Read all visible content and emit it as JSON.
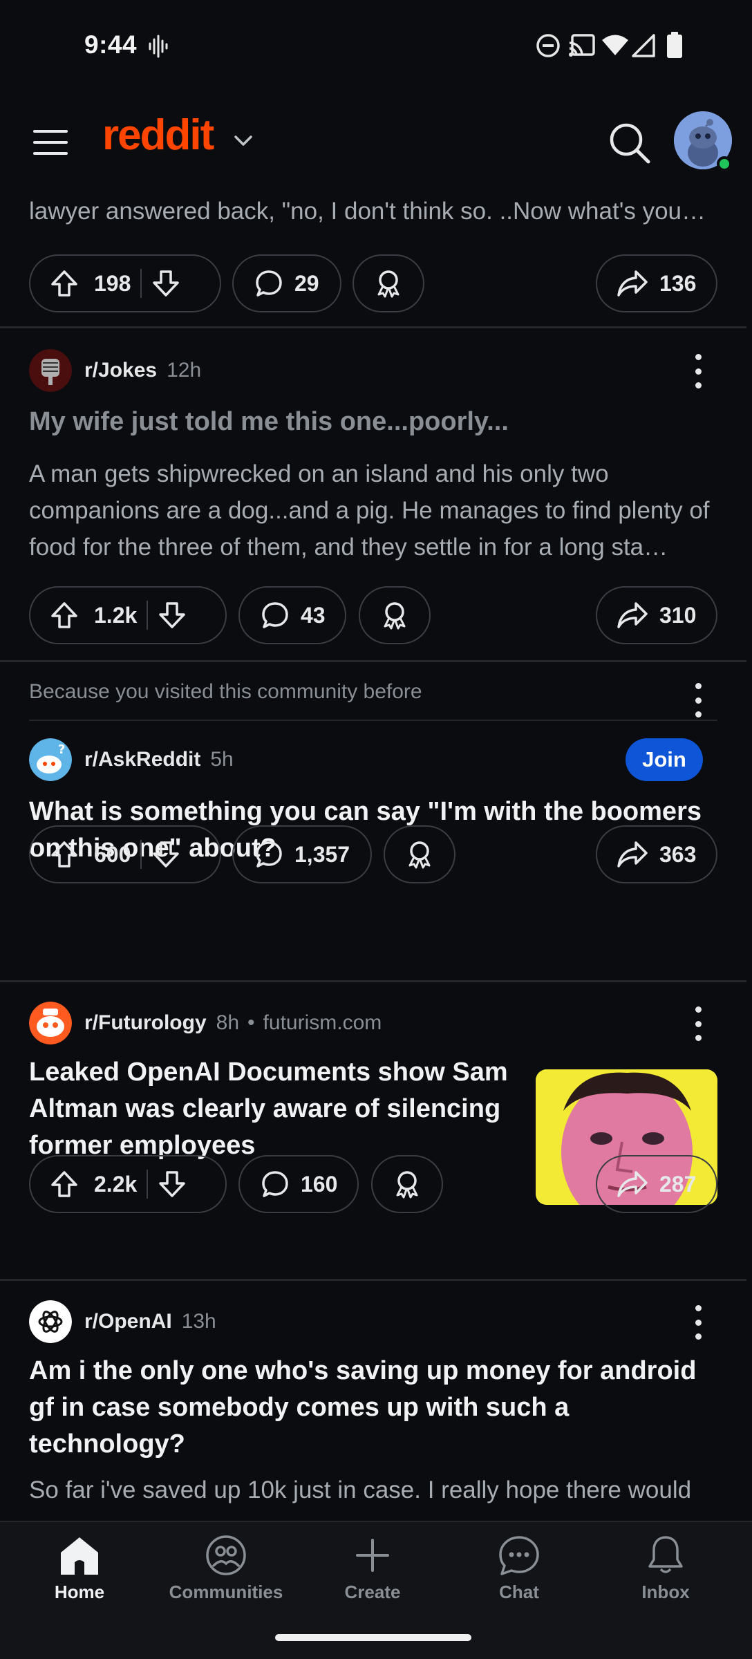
{
  "status_bar": {
    "time": "9:44",
    "icons": [
      "voicemail-waveform-icon",
      "do-not-disturb-icon",
      "cast-icon",
      "wifi-icon",
      "cellular-signal-icon",
      "battery-icon"
    ]
  },
  "header": {
    "logo": "reddit",
    "icons": [
      "menu-icon",
      "chevron-down-icon",
      "search-icon",
      "avatar-icon"
    ],
    "brand_color": "#ff4500"
  },
  "feed": {
    "post0": {
      "teaser": "lawyer answered back, \"no, I don't think so. ..Now what's you…",
      "upvotes": "198",
      "comments": "29",
      "shares": "136"
    },
    "post1": {
      "subreddit": "r/Jokes",
      "age": "12h",
      "title": "My wife just told me this one...poorly...",
      "body": "A man gets shipwrecked on an island and his only two companions are a dog...and a pig. He manages to find plenty of food for the three of them, and they settle in for a long sta…",
      "upvotes": "1.2k",
      "comments": "43",
      "shares": "310"
    },
    "post2": {
      "reason": "Because you visited this community before",
      "subreddit": "r/AskReddit",
      "age": "5h",
      "join_label": "Join",
      "title": "What is something you can say \"I'm with the boomers on this one\" about?",
      "upvotes": "600",
      "comments": "1,357",
      "shares": "363"
    },
    "post3": {
      "subreddit": "r/Futurology",
      "age": "8h",
      "domain": "futurism.com",
      "title": "Leaked OpenAI Documents show Sam Altman was clearly aware of silencing former employees",
      "upvotes": "2.2k",
      "comments": "160",
      "shares": "287"
    },
    "post4": {
      "subreddit": "r/OpenAI",
      "age": "13h",
      "title": "Am i the only one who's saving up money for android gf in case somebody comes up with such a technology?",
      "body": "So far i've saved up 10k just in case. I really hope there would"
    }
  },
  "bottom_nav": {
    "home": "Home",
    "communities": "Communities",
    "create": "Create",
    "chat": "Chat",
    "inbox": "Inbox"
  },
  "colors": {
    "background": "#0b0c0f",
    "join_button": "#0e55d8",
    "online": "#21c35b"
  }
}
